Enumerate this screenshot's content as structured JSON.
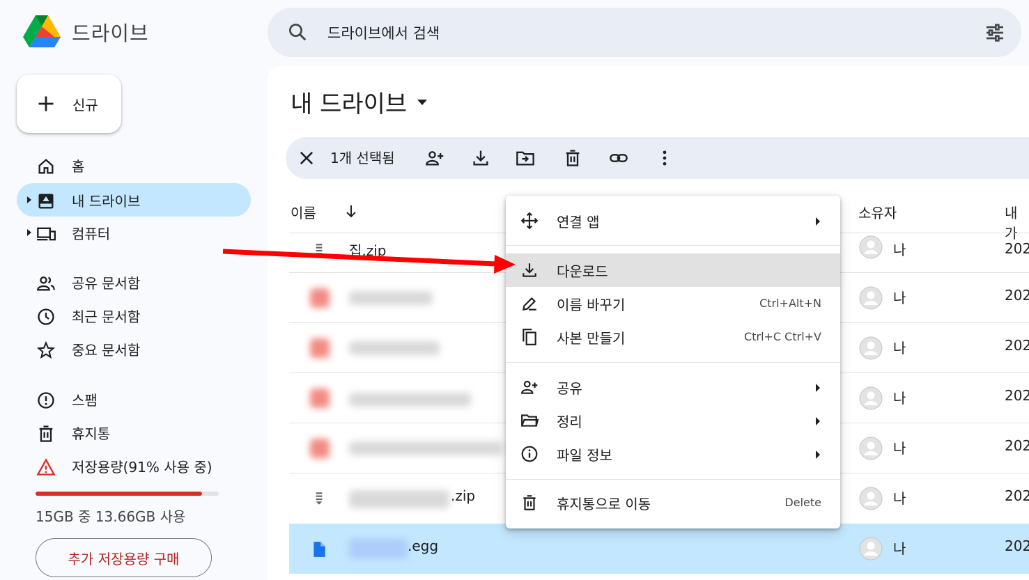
{
  "app": {
    "name": "드라이브"
  },
  "search": {
    "placeholder": "드라이브에서 검색"
  },
  "sidebar": {
    "new_label": "신규",
    "items": [
      {
        "label": "홈",
        "icon": "home-icon"
      },
      {
        "label": "내 드라이브",
        "icon": "my-drive-icon",
        "active": true
      },
      {
        "label": "컴퓨터",
        "icon": "computer-icon"
      },
      {
        "label": "공유 문서함",
        "icon": "people-icon"
      },
      {
        "label": "최근 문서함",
        "icon": "clock-icon"
      },
      {
        "label": "중요 문서함",
        "icon": "star-icon"
      },
      {
        "label": "스팸",
        "icon": "spam-icon"
      },
      {
        "label": "휴지통",
        "icon": "trash-icon"
      },
      {
        "label": "저장용량(91% 사용 중)",
        "icon": "warning-icon"
      }
    ],
    "storage": {
      "used_fraction": 0.91,
      "text": "15GB 중 13.66GB 사용",
      "buy_label": "추가 저장용량 구매"
    }
  },
  "main": {
    "title": "내 드라이브",
    "selection": {
      "count_text": "1개 선택됨"
    },
    "columns": {
      "name": "이름",
      "owner": "소유자",
      "modified": "내가"
    },
    "rows": [
      {
        "name": "집.zip",
        "owner": "나",
        "date": "202"
      },
      {
        "name": "",
        "owner": "나",
        "date": "202"
      },
      {
        "name": "",
        "owner": "나",
        "date": "202"
      },
      {
        "name": "",
        "owner": "나",
        "date": "202"
      },
      {
        "name": "",
        "owner": "나",
        "date": "202"
      },
      {
        "name": ".zip",
        "owner": "나",
        "date": "202"
      },
      {
        "name": ".egg",
        "owner": "나",
        "date": "202",
        "selected": true
      }
    ]
  },
  "context_menu": {
    "items": [
      {
        "label": "연결 앱",
        "icon": "open-with-icon",
        "submenu": true
      },
      {
        "label": "다운로드",
        "icon": "download-icon",
        "highlighted": true
      },
      {
        "label": "이름 바꾸기",
        "icon": "rename-icon",
        "shortcut": "Ctrl+Alt+N"
      },
      {
        "label": "사본 만들기",
        "icon": "copy-icon",
        "shortcut": "Ctrl+C Ctrl+V"
      },
      {
        "label": "공유",
        "icon": "share-icon",
        "submenu": true
      },
      {
        "label": "정리",
        "icon": "folder-icon",
        "submenu": true
      },
      {
        "label": "파일 정보",
        "icon": "info-icon",
        "submenu": true
      },
      {
        "label": "휴지통으로 이동",
        "icon": "trash-icon",
        "shortcut": "Delete"
      }
    ]
  },
  "colors": {
    "accent": "#c2e7ff",
    "storage_warning": "#d93025",
    "annotation_arrow": "#ff0000"
  }
}
